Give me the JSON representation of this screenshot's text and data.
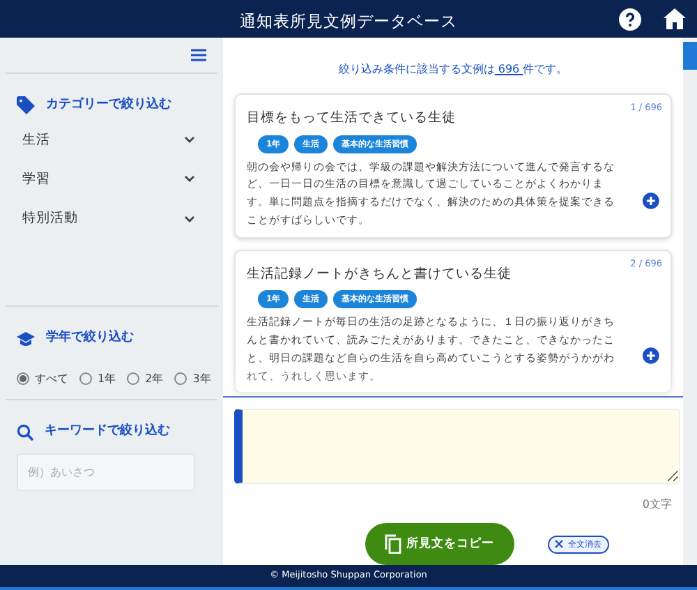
{
  "header": {
    "title": "通知表所見文例データベース"
  },
  "sidebar": {
    "category_filter": {
      "title": "カテゴリーで絞り込む",
      "items": [
        {
          "label": "生活",
          "expanded": false
        },
        {
          "label": "学習",
          "expanded": false
        },
        {
          "label": "特別活動",
          "expanded": false
        }
      ]
    },
    "grade_filter": {
      "title": "学年で絞り込む",
      "options": [
        {
          "label": "すべて",
          "selected": true
        },
        {
          "label": "1年",
          "selected": false
        },
        {
          "label": "2年",
          "selected": false
        },
        {
          "label": "3年",
          "selected": false
        }
      ]
    },
    "keyword_filter": {
      "title": "キーワードで絞り込む",
      "placeholder": "例）あいさつ"
    }
  },
  "results": {
    "summary_before": "絞り込み条件に該当する文例は",
    "count": "696",
    "summary_after": "件です。",
    "items": [
      {
        "index": "1 / 696",
        "title": "目標をもって生活できている生徒",
        "tags": [
          "1年",
          "生活",
          "基本的な生活習慣"
        ],
        "text": "朝の会や帰りの会では、学級の課題や解決方法について進んで発言するなど、一日一日の生活の目標を意識して過ごしていることがよくわかります。単に問題点を指摘するだけでなく、解決のための具体策を提案できることがすばらしいです。"
      },
      {
        "index": "2 / 696",
        "title": "生活記録ノートがきちんと書けている生徒",
        "tags": [
          "1年",
          "生活",
          "基本的な生活習慣"
        ],
        "text": "生活記録ノートが毎日の生活の足跡となるように、１日の振り返りがきちんと書かれていて、読みごたえがあります。できたこと、できなかったこと、明日の課題など自らの生活を自ら高めていこうとする姿勢がうかがわれて、うれしく思います。"
      }
    ]
  },
  "editor": {
    "char_count": "0文字",
    "copy_button": "所見文をコピー",
    "clear_button": "全文消去"
  },
  "footer": {
    "copyright": "© Meijitosho Shuppan Corporation"
  }
}
